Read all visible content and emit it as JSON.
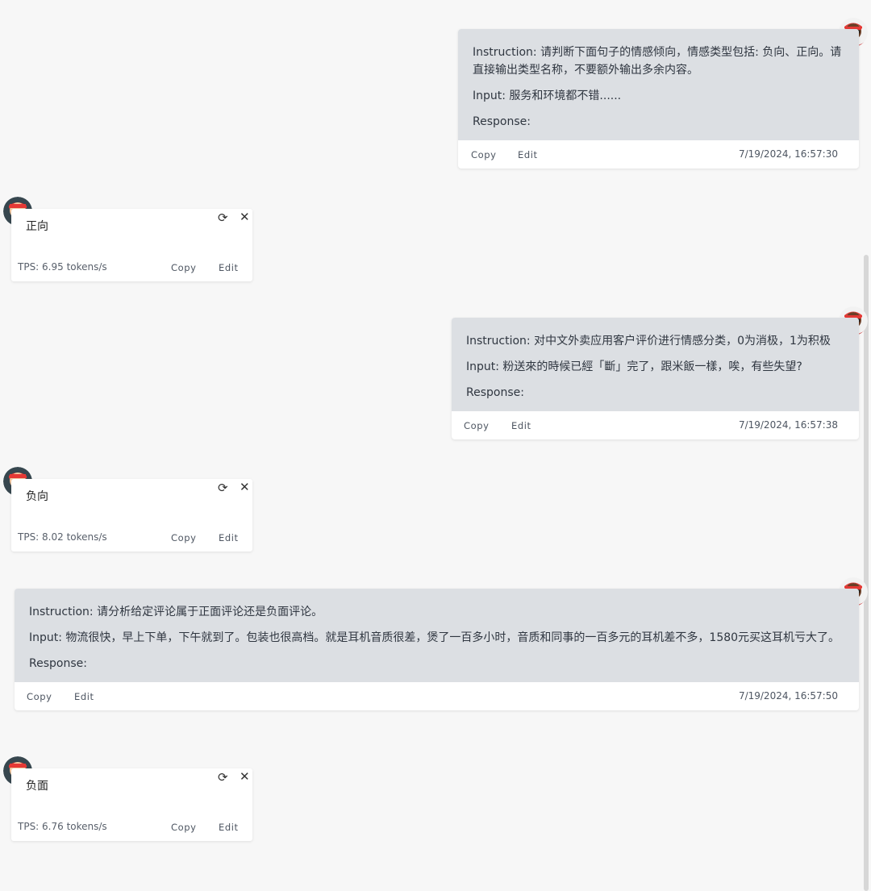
{
  "messages": [
    {
      "role": "user",
      "lines": [
        "Instruction: 请判断下面句子的情感倾向，情感类型包括: 负向、正向。请直接输出类型名称，不要额外输出多余内容。",
        "Input: 服务和环境都不错......",
        "Response:"
      ],
      "copy_label": "Copy",
      "edit_label": "Edit",
      "timestamp": "7/19/2024, 16:57:30"
    },
    {
      "role": "assistant",
      "text": "正向",
      "tps": "TPS: 6.95 tokens/s",
      "copy_label": "Copy",
      "edit_label": "Edit"
    },
    {
      "role": "user",
      "lines": [
        "Instruction: 对中文外卖应用客户评价进行情感分类，0为消极，1为积极",
        "Input: 粉送來的時候已經「斷」完了，跟米飯一樣，唉，有些失望?",
        "Response:"
      ],
      "copy_label": "Copy",
      "edit_label": "Edit",
      "timestamp": "7/19/2024, 16:57:38"
    },
    {
      "role": "assistant",
      "text": "负向",
      "tps": "TPS: 8.02 tokens/s",
      "copy_label": "Copy",
      "edit_label": "Edit"
    },
    {
      "role": "user",
      "lines": [
        "Instruction: 请分析给定评论属于正面评论还是负面评论。",
        "Input: 物流很快，早上下单，下午就到了。包装也很高档。就是耳机音质很差，煲了一百多小时，音质和同事的一百多元的耳机差不多，1580元买这耳机亏大了。",
        "Response:"
      ],
      "copy_label": "Copy",
      "edit_label": "Edit",
      "timestamp": "7/19/2024, 16:57:50"
    },
    {
      "role": "assistant",
      "text": "负面",
      "tps": "TPS: 6.76 tokens/s",
      "copy_label": "Copy",
      "edit_label": "Edit"
    }
  ],
  "icons": {
    "regenerate": "regenerate-icon",
    "close": "close-icon",
    "user_avatar": "user-avatar-icon",
    "assistant_avatar": "assistant-avatar-icon"
  },
  "colors": {
    "page_bg": "#f7f7f7",
    "user_bubble": "#dcdfe3",
    "card_bg": "#ffffff",
    "avatar_red": "#e53935"
  }
}
